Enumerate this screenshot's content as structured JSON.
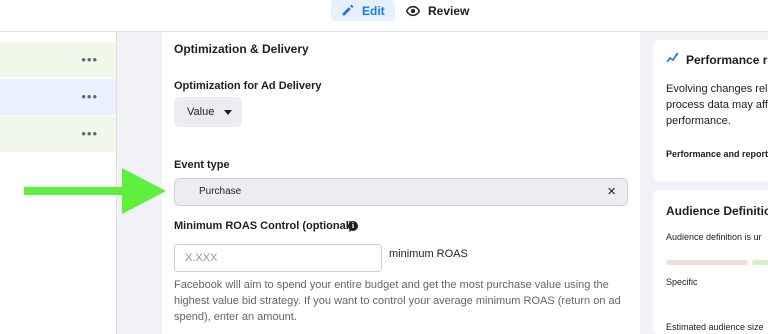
{
  "tabs": {
    "edit_label": "Edit",
    "review_label": "Review"
  },
  "left_panel": {
    "rows": [
      {
        "color": "#f1f7e9",
        "menu_glyph": "•••"
      },
      {
        "color": "#eaf1fd",
        "menu_glyph": "•••"
      },
      {
        "color": "#f1f7e9",
        "menu_glyph": "•••"
      }
    ]
  },
  "optimization": {
    "section_title": "Optimization & Delivery",
    "opt_label": "Optimization for Ad Delivery",
    "opt_value": "Value",
    "event_label": "Event type",
    "event_value": "Purchase",
    "event_clear_glyph": "×",
    "roas_label": "Minimum ROAS Control (optional)",
    "info_glyph": "i",
    "roas_placeholder": "X.XXX",
    "roas_suffix": "minimum ROAS",
    "help_text": "Facebook will aim to spend your entire budget and get the most purchase value using the highest value bid strategy. If you want to control your average minimum ROAS (return on ad spend), enter an amount."
  },
  "performance_card": {
    "title": "Performance r",
    "body": "Evolving changes rel process data may aff performance.",
    "link": "Performance and report"
  },
  "audience_card": {
    "title": "Audience Definitio",
    "subtitle": "Audience definition is ur",
    "specific_label": "Specific",
    "size_label": "Estimated audience size"
  },
  "colors": {
    "accent": "#1877f2",
    "arrow": "#5ef03c",
    "bar_red": "#f6dcd9",
    "bar_green": "#d8f0c8"
  },
  "icons": {
    "edit": "pencil-icon",
    "review": "eye-icon",
    "performance": "sparkle-chart-icon",
    "info": "info-icon",
    "clear": "close-icon",
    "dropdown": "caret-down-icon",
    "annotation": "green-arrow-icon"
  }
}
